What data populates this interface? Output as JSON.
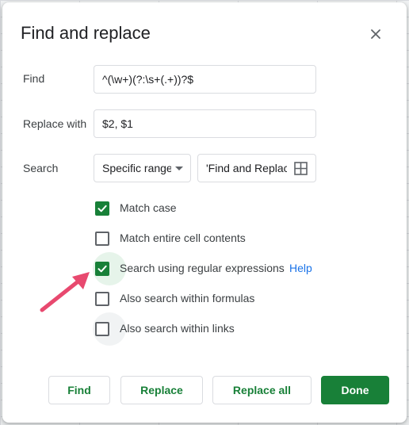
{
  "dialog": {
    "title": "Find and replace"
  },
  "find": {
    "label": "Find",
    "value": "^(\\w+)(?:\\s+(.+))?$"
  },
  "replace": {
    "label": "Replace with",
    "value": "$2, $1"
  },
  "search": {
    "label": "Search",
    "scope_value": "Specific range",
    "range_value": "'Find and Replac"
  },
  "options": [
    {
      "label": "Match case",
      "checked": true
    },
    {
      "label": "Match entire cell contents",
      "checked": false
    },
    {
      "label": "Search using regular expressions",
      "checked": true,
      "help": "Help"
    },
    {
      "label": "Also search within formulas",
      "checked": false
    },
    {
      "label": "Also search within links",
      "checked": false
    }
  ],
  "buttons": {
    "find": "Find",
    "replace": "Replace",
    "replace_all": "Replace all",
    "done": "Done"
  },
  "colors": {
    "accent": "#188038",
    "link": "#1a73e8",
    "annotation_arrow": "#e8496f"
  },
  "icons": {
    "close": "close-icon",
    "range_picker": "grid-icon",
    "dropdown": "caret-down-icon",
    "annotation": "arrow-annotation"
  }
}
